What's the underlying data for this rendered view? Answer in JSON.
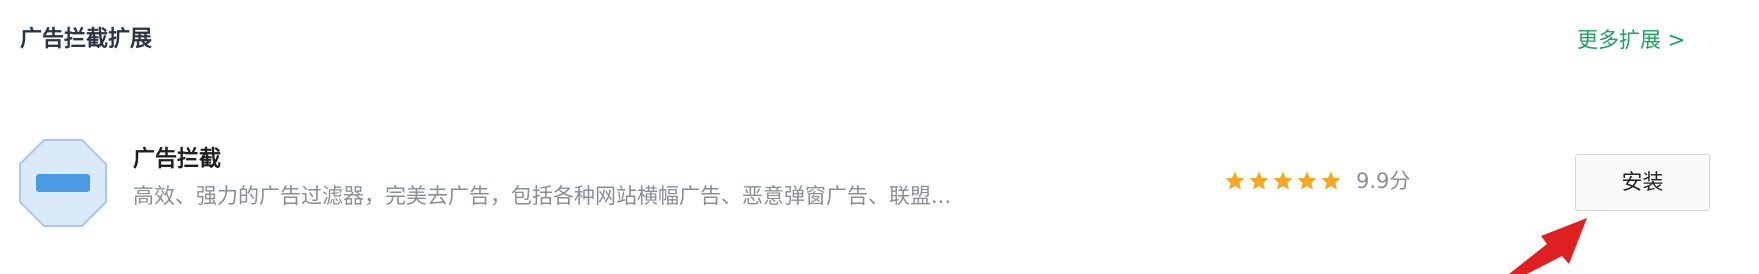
{
  "section": {
    "title": "广告拦截扩展",
    "more_link": "更多扩展 >"
  },
  "extension": {
    "name": "广告拦截",
    "description": "高效、强力的广告过滤器，完美去广告，包括各种网站横幅广告、恶意弹窗广告、联盟...",
    "icon": "adblock-stop-sign-icon",
    "rating_stars": 5,
    "score": "9.9分",
    "install_label": "安装"
  },
  "colors": {
    "accent": "#1aa35c",
    "star": "#f5a623",
    "icon_bg": "#dbeaf9",
    "icon_bar": "#4a9be4",
    "arrow": "#e02020"
  }
}
